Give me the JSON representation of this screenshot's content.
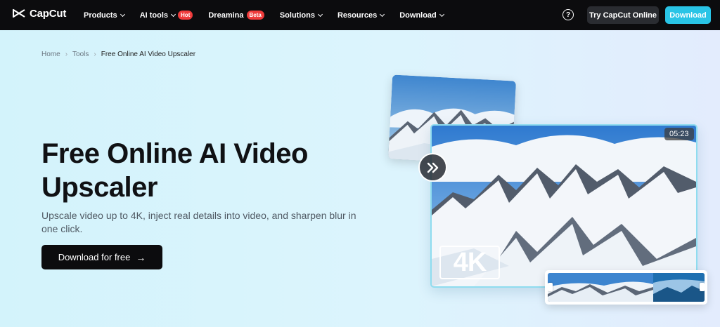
{
  "brand": {
    "name": "CapCut"
  },
  "nav": {
    "items": [
      {
        "label": "Products",
        "has_dropdown": true
      },
      {
        "label": "AI tools",
        "has_dropdown": true,
        "badge": "Hot"
      },
      {
        "label": "Dreamina",
        "has_dropdown": false,
        "badge": "Beta"
      },
      {
        "label": "Solutions",
        "has_dropdown": true
      },
      {
        "label": "Resources",
        "has_dropdown": true
      },
      {
        "label": "Download",
        "has_dropdown": true
      }
    ],
    "help_icon": "question-circle-icon",
    "try_online_label": "Try CapCut Online",
    "download_label": "Download"
  },
  "breadcrumb": {
    "home": "Home",
    "tools": "Tools",
    "current": "Free Online AI Video Upscaler"
  },
  "hero": {
    "title": "Free Online AI Video Upscaler",
    "subtitle": "Upscale video up to 4K, inject real details into video, and sharpen blur in one click.",
    "cta_label": "Download for free",
    "cta_icon": "arrow-right-icon"
  },
  "preview": {
    "duration": "05:23",
    "quality_label": "4K",
    "play_icon": "double-chevron-right-icon"
  },
  "colors": {
    "accent": "#29c4e6",
    "badge": "#ef3b3b",
    "nav_bg": "#0c0c0e"
  }
}
